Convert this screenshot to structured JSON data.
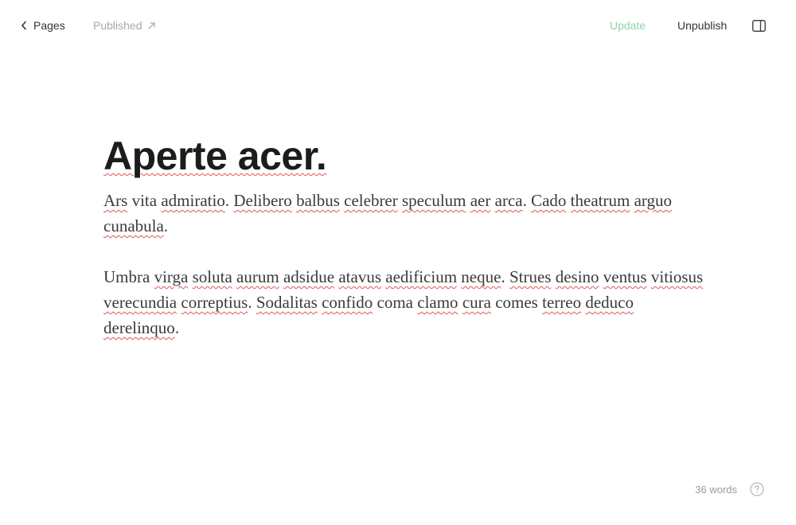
{
  "topbar": {
    "back_label": "Pages",
    "status_label": "Published",
    "update_label": "Update",
    "unpublish_label": "Unpublish"
  },
  "document": {
    "title": "Aperte acer.",
    "paragraphs": [
      [
        {
          "t": "Ars",
          "sp": true
        },
        {
          "t": " vita "
        },
        {
          "t": "admiratio",
          "sp": true
        },
        {
          "t": ". "
        },
        {
          "t": "Delibero",
          "sp": true
        },
        {
          "t": " "
        },
        {
          "t": "balbus",
          "sp": true
        },
        {
          "t": " "
        },
        {
          "t": "celebrer",
          "sp": true
        },
        {
          "t": " "
        },
        {
          "t": "speculum",
          "sp": true
        },
        {
          "t": " "
        },
        {
          "t": "aer",
          "sp": true
        },
        {
          "t": " "
        },
        {
          "t": "arca",
          "sp": true
        },
        {
          "t": ". "
        },
        {
          "t": "Cado",
          "sp": true
        },
        {
          "t": " "
        },
        {
          "t": "theatrum",
          "sp": true
        },
        {
          "t": " "
        },
        {
          "t": "arguo",
          "sp": true
        },
        {
          "t": " "
        },
        {
          "t": "cunabula",
          "sp": true
        },
        {
          "t": "."
        }
      ],
      [
        {
          "t": "Umbra "
        },
        {
          "t": "virga",
          "sp": true
        },
        {
          "t": " "
        },
        {
          "t": "soluta",
          "sp": true
        },
        {
          "t": " "
        },
        {
          "t": "aurum",
          "sp": true
        },
        {
          "t": " "
        },
        {
          "t": "adsidue",
          "sp": true
        },
        {
          "t": " "
        },
        {
          "t": "atavus",
          "sp": true
        },
        {
          "t": " "
        },
        {
          "t": "aedificium",
          "sp": true
        },
        {
          "t": " "
        },
        {
          "t": "neque",
          "sp": true
        },
        {
          "t": ". "
        },
        {
          "t": "Strues",
          "sp": true
        },
        {
          "t": " "
        },
        {
          "t": "desino",
          "sp": true
        },
        {
          "t": " "
        },
        {
          "t": "ventus",
          "sp": true
        },
        {
          "t": " "
        },
        {
          "t": "vitiosus",
          "sp": true
        },
        {
          "t": " "
        },
        {
          "t": "verecundia",
          "sp": true
        },
        {
          "t": " "
        },
        {
          "t": "correptius",
          "sp": true
        },
        {
          "t": ". "
        },
        {
          "t": "Sodalitas",
          "sp": true
        },
        {
          "t": " "
        },
        {
          "t": "confido",
          "sp": true
        },
        {
          "t": " coma "
        },
        {
          "t": "clamo",
          "sp": true
        },
        {
          "t": " "
        },
        {
          "t": "cura",
          "sp": true
        },
        {
          "t": " comes "
        },
        {
          "t": "terreo",
          "sp": true
        },
        {
          "t": " "
        },
        {
          "t": "deduco",
          "sp": true
        },
        {
          "t": " "
        },
        {
          "t": "derelinquo",
          "sp": true
        },
        {
          "t": "."
        }
      ]
    ]
  },
  "footer": {
    "word_count": "36 words"
  },
  "icons": {
    "back": "chevron-left-icon",
    "external": "external-link-icon",
    "sidebar": "sidebar-toggle-icon",
    "help": "help-icon"
  },
  "colors": {
    "update": "#8fd3a6",
    "spellcheck": "#e25555"
  }
}
